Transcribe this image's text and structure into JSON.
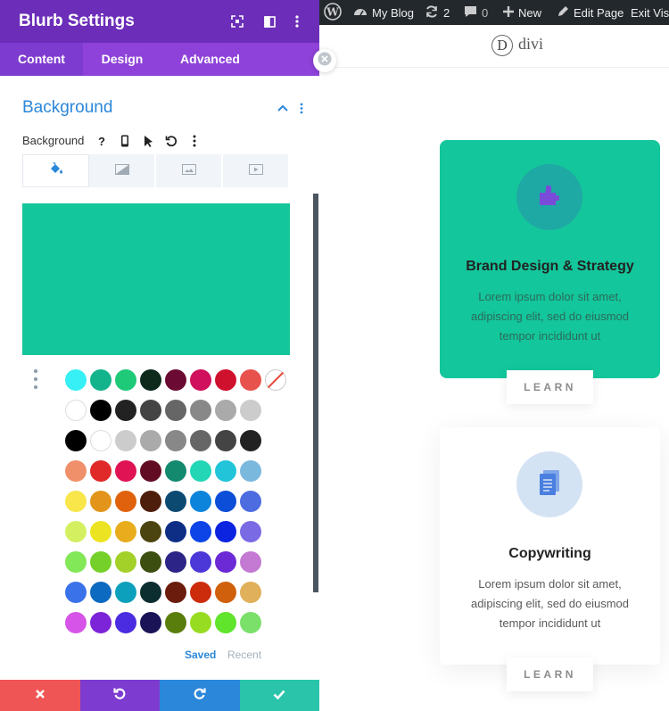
{
  "panel": {
    "title": "Blurb Settings",
    "tabs": [
      {
        "label": "Content",
        "active": true
      },
      {
        "label": "Design",
        "active": false
      },
      {
        "label": "Advanced",
        "active": false
      }
    ],
    "section_title": "Background",
    "option_label": "Background",
    "help_glyph": "?",
    "background_tabs": [
      "paint-bucket-icon",
      "gradient-icon",
      "image-icon",
      "video-icon"
    ],
    "selected_color": "#13c69b",
    "swatch_rows": [
      [
        "#37f0f5",
        "#13b48c",
        "#1ec978",
        "#0e2a1d",
        "#6b0b33",
        "#d0105d",
        "#d0112e",
        "#e8524d",
        "none"
      ],
      [
        "#ffffff",
        "#000000",
        "#222222",
        "#444444",
        "#666666",
        "#888888",
        "#aaaaaa",
        "#cccccc"
      ],
      [
        "#000000",
        "#ffffff",
        "#cccccc",
        "#aaaaaa",
        "#888888",
        "#666666",
        "#444444",
        "#222222"
      ],
      [
        "#f0906a",
        "#e02a2a",
        "#e01454",
        "#620c24",
        "#138a6e",
        "#23d6b6",
        "#21c4d8",
        "#7bb8dd"
      ],
      [
        "#f8e64a",
        "#e2951a",
        "#e0620c",
        "#4e1e0c",
        "#0c4a72",
        "#0c84dc",
        "#0c4ed8",
        "#4d6ce0"
      ],
      [
        "#d4f060",
        "#ece422",
        "#e8ac1c",
        "#4c4410",
        "#0e2e86",
        "#0c44e8",
        "#0c24e0",
        "#7a6ae4"
      ],
      [
        "#82e858",
        "#76d02a",
        "#a4d02a",
        "#3c4e10",
        "#2c2486",
        "#4c38d8",
        "#6c2ad6",
        "#c47ad2"
      ],
      [
        "#3a72ea",
        "#0c6ac0",
        "#0ca0bc",
        "#0c2e30",
        "#6c1c0c",
        "#cc2c0c",
        "#d0600c",
        "#e0b05a"
      ],
      [
        "#d654e8",
        "#7c24d8",
        "#4c2ce0",
        "#1a1456",
        "#5a7e0c",
        "#98dc22",
        "#60e42c",
        "#7ae06a"
      ]
    ],
    "saved_label": "Saved",
    "recent_label": "Recent",
    "actions": [
      {
        "name": "discard",
        "color": "#ef5555"
      },
      {
        "name": "undo",
        "color": "#7e3bd0"
      },
      {
        "name": "redo",
        "color": "#2b87da"
      },
      {
        "name": "save",
        "color": "#29c4a9"
      }
    ]
  },
  "wp_bar": {
    "site_name": "My Blog",
    "updates_count": "2",
    "comments_count": "0",
    "new_label": "New",
    "edit_label": "Edit Page",
    "exit_label": "Exit Visu"
  },
  "site": {
    "logo_letter": "D",
    "logo_text": "divi"
  },
  "cards": [
    {
      "title": "Brand Design & Strategy",
      "text": "Lorem ipsum dolor sit amet, adipiscing elit, sed do eiusmod tempor incididunt ut",
      "button": "LEARN",
      "bg": "#13c69b",
      "icon": "puzzle-icon"
    },
    {
      "title": "Copywriting",
      "text": "Lorem ipsum dolor sit amet, adipiscing elit, sed do eiusmod tempor incididunt ut",
      "button": "LEARN",
      "bg": "#ffffff",
      "icon": "document-icon"
    }
  ]
}
